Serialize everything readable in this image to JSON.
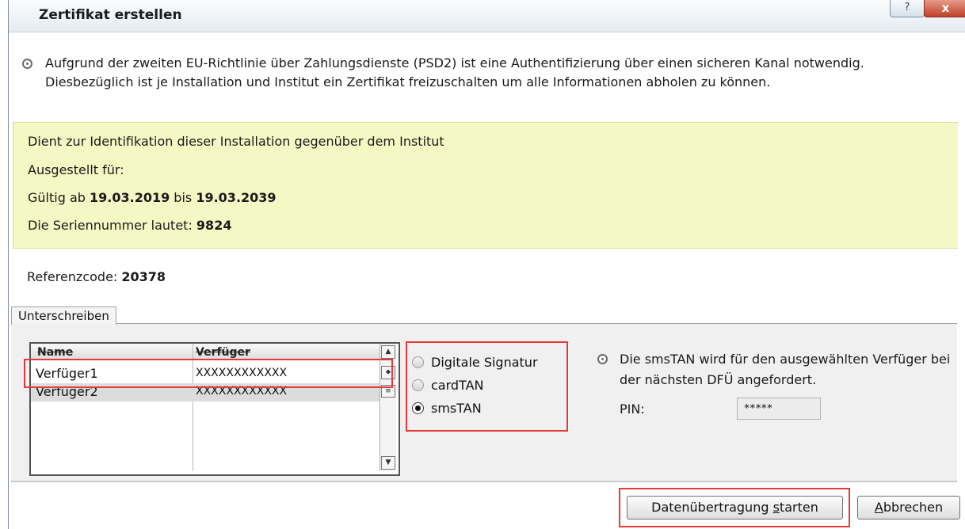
{
  "window": {
    "title": "Zertifikat erstellen",
    "help_label": "?",
    "close_label": "x"
  },
  "intro": {
    "text": "Aufgrund der zweiten EU-Richtlinie über Zahlungsdienste (PSD2) ist eine Authentifizierung über einen sicheren Kanal notwendig. Diesbezüglich ist je Installation und Institut ein Zertifikat freizuschalten um alle Informationen abholen zu können."
  },
  "certificate": {
    "identification": "Dient zur Identifikation dieser Installation gegenüber dem Institut",
    "issued_for_label": "Ausgestellt für:",
    "valid_prefix": "Gültig ab ",
    "valid_from": "19.03.2019",
    "valid_mid": " bis ",
    "valid_to": "19.03.2039",
    "serial_label": "Die Seriennummer lautet: ",
    "serial_value": "9824"
  },
  "reference": {
    "label": "Referenzcode: ",
    "value": "20378"
  },
  "tabs": [
    {
      "label": "Unterschreiben"
    }
  ],
  "signer_table": {
    "columns": [
      "Name",
      "Verfüger"
    ],
    "rows": [
      {
        "name": "Verfüger1",
        "value": "XXXXXXXXXXXX"
      },
      {
        "name": "Verfüger2",
        "value": "XXXXXXXXXXXX"
      }
    ]
  },
  "methods": {
    "options": [
      "Digitale Signatur",
      "cardTAN",
      "smsTAN"
    ],
    "selected": "smsTAN"
  },
  "sms_info": {
    "text": "Die smsTAN wird für den ausgewählten Verfüger bei der nächsten DFÜ angefordert.",
    "pin_label": "PIN:",
    "pin_value": "*****"
  },
  "buttons": {
    "start_pre": "Datenübertragung ",
    "start_accel": "s",
    "start_post": "tarten",
    "cancel_accel": "A",
    "cancel_post": "bbrechen"
  },
  "colors": {
    "highlight": "#e43a3a",
    "cert_background": "#f4f8c4"
  }
}
